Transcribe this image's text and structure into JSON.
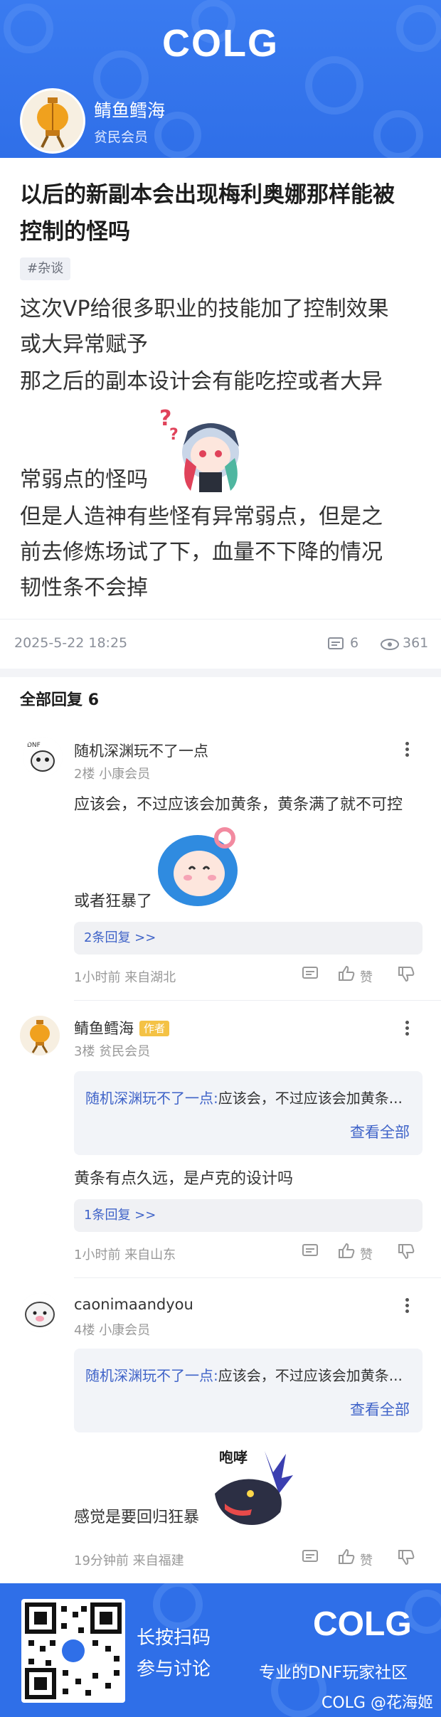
{
  "header": {
    "brand": "COLG",
    "username": "鲭鱼鳕海",
    "user_level": "贫民会员"
  },
  "post": {
    "title_line1": "以后的新副本会出现梅利奥娜那样能被",
    "title_line2": "控制的怪吗",
    "tag": "#杂谈",
    "body": [
      "这次VP给很多职业的技能加了控制效果",
      "或大异常赋予",
      "那之后的副本设计会有能吃控或者大异",
      "常弱点的怪吗",
      "但是人造神有些怪有异常弱点，但是之",
      "前去修炼场试了下，血量不下降的情况",
      "韧性条不会掉"
    ],
    "date": "2025-5-22 18:25",
    "comment_count": "6",
    "view_count": "361"
  },
  "replies": {
    "header_label": "全部回复",
    "header_count": "6",
    "items": [
      {
        "name": "随机深渊玩不了一点",
        "floor": "2楼",
        "level": "小康会员",
        "text_line1": "应该会，不过应该会加黄条，黄条满了就不可控",
        "text_line2": "或者狂暴了",
        "sub_replies": "2条回复 >>",
        "time": "1小时前",
        "location": "来自湖北",
        "like_label": "赞"
      },
      {
        "name": "鲭鱼鳕海",
        "badge": "作者",
        "floor": "3楼",
        "level": "贫民会员",
        "quote_author": "随机深渊玩不了一点:",
        "quote_text": "应该会，不过应该会加黄条...",
        "view_all": "查看全部",
        "text": "黄条有点久远，是卢克的设计吗",
        "sub_replies": "1条回复 >>",
        "time": "1小时前",
        "location": "来自山东",
        "like_label": "赞"
      },
      {
        "name": "caonimaandyou",
        "floor": "4楼",
        "level": "小康会员",
        "quote_author": "随机深渊玩不了一点:",
        "quote_text": "应该会，不过应该会加黄条...",
        "view_all": "查看全部",
        "sticker_text": "咆哮",
        "text": "感觉是要回归狂暴",
        "time": "19分钟前",
        "location": "来自福建",
        "like_label": "赞"
      }
    ]
  },
  "footer": {
    "line1": "长按扫码",
    "line2": "参与讨论",
    "brand": "COLG",
    "slogan": "专业的DNF玩家社区",
    "watermark": "COLG @花海姬"
  },
  "colors": {
    "brand_blue": "#2f6fe8",
    "link_blue": "#3f63c8",
    "author_badge": "#f4c245"
  }
}
